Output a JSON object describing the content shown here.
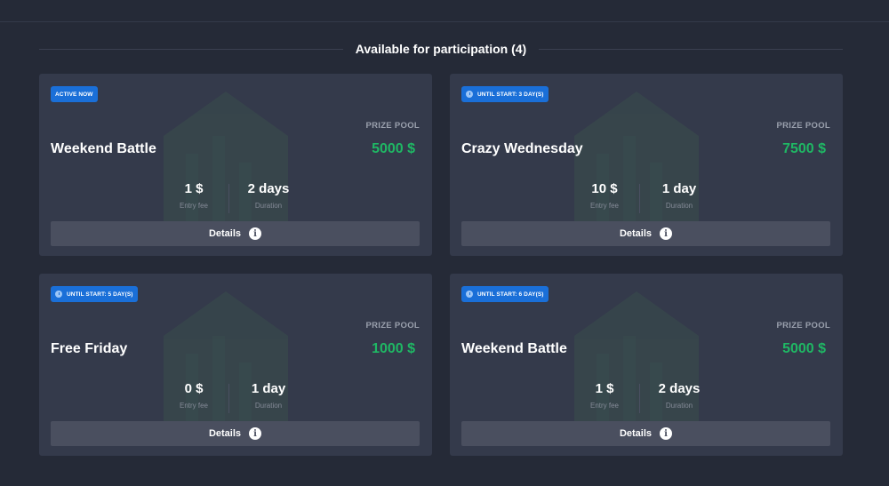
{
  "section": {
    "title": "Available for participation (4)"
  },
  "cards": [
    {
      "badge": "ACTIVE NOW",
      "badge_icon": "",
      "prize_label": "PRIZE POOL",
      "title": "Weekend Battle",
      "prize": "5000 $",
      "entry_fee": "1 $",
      "entry_fee_label": "Entry fee",
      "duration": "2 days",
      "duration_label": "Duration",
      "details_label": "Details"
    },
    {
      "badge": "UNTIL START: 3 DAY(S)",
      "badge_icon": "clock-icon",
      "prize_label": "PRIZE POOL",
      "title": "Crazy Wednesday",
      "prize": "7500 $",
      "entry_fee": "10 $",
      "entry_fee_label": "Entry fee",
      "duration": "1 day",
      "duration_label": "Duration",
      "details_label": "Details"
    },
    {
      "badge": "UNTIL START: 5 DAY(S)",
      "badge_icon": "clock-icon",
      "prize_label": "PRIZE POOL",
      "title": "Free Friday",
      "prize": "1000 $",
      "entry_fee": "0 $",
      "entry_fee_label": "Entry fee",
      "duration": "1 day",
      "duration_label": "Duration",
      "details_label": "Details"
    },
    {
      "badge": "UNTIL START: 6 DAY(S)",
      "badge_icon": "clock-icon",
      "prize_label": "PRIZE POOL",
      "title": "Weekend Battle",
      "prize": "5000 $",
      "entry_fee": "1 $",
      "entry_fee_label": "Entry fee",
      "duration": "2 days",
      "duration_label": "Duration",
      "details_label": "Details"
    }
  ],
  "colors": {
    "background": "#252a37",
    "card": "#343a4b",
    "badge": "#1a6fd8",
    "prize": "#1fb764",
    "button": "#4a4f5f"
  },
  "icons": {
    "details": "info-icon",
    "badge_timer": "clock-icon"
  }
}
